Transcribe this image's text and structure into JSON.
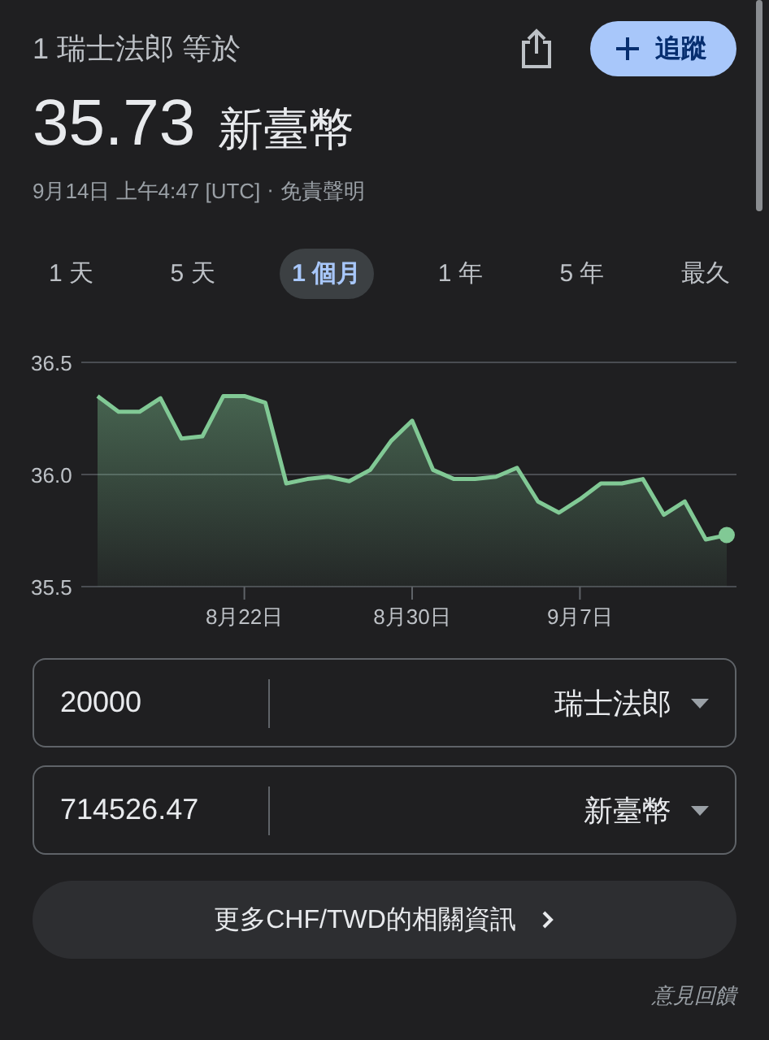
{
  "header": {
    "title": "1 瑞士法郎 等於",
    "follow_label": "追蹤"
  },
  "rate": {
    "value": "35.73",
    "unit": "新臺幣"
  },
  "meta": {
    "timestamp": "9月14日 上午4:47 [UTC]",
    "separator": "·",
    "disclaimer_link": "免責聲明"
  },
  "range_tabs": [
    {
      "label": "1 天",
      "selected": false
    },
    {
      "label": "5 天",
      "selected": false
    },
    {
      "label": "1 個月",
      "selected": true
    },
    {
      "label": "1 年",
      "selected": false
    },
    {
      "label": "5 年",
      "selected": false
    },
    {
      "label": "最久",
      "selected": false
    }
  ],
  "chart": {
    "chart_data": {
      "type": "area",
      "categories": [
        null,
        null,
        null,
        null,
        null,
        null,
        null,
        "8月22日",
        null,
        null,
        null,
        null,
        null,
        null,
        null,
        "8月30日",
        null,
        null,
        null,
        null,
        null,
        null,
        null,
        "9月7日",
        null,
        null,
        null,
        null,
        null,
        null,
        null
      ],
      "series": [
        {
          "color": "#81c995",
          "values": [
            36.35,
            36.28,
            36.28,
            36.34,
            36.16,
            36.17,
            36.35,
            36.35,
            36.32,
            35.96,
            35.98,
            35.99,
            35.97,
            36.02,
            36.15,
            36.24,
            36.02,
            35.98,
            35.98,
            35.99,
            36.03,
            35.88,
            35.83,
            35.89,
            35.96,
            35.96,
            35.98,
            35.82,
            35.88,
            35.71,
            35.73
          ]
        }
      ],
      "ylim": [
        35.5,
        36.5
      ],
      "yticks": [
        35.5,
        {
          "value": 36,
          "label": "36.0"
        },
        36.5
      ]
    }
  },
  "converter": [
    {
      "amount": "20000",
      "currency": "瑞士法郎"
    },
    {
      "amount": "714526.47",
      "currency": "新臺幣"
    }
  ],
  "more_info_button": "更多CHF/TWD的相關資訊",
  "feedback_link": "意見回饋"
}
